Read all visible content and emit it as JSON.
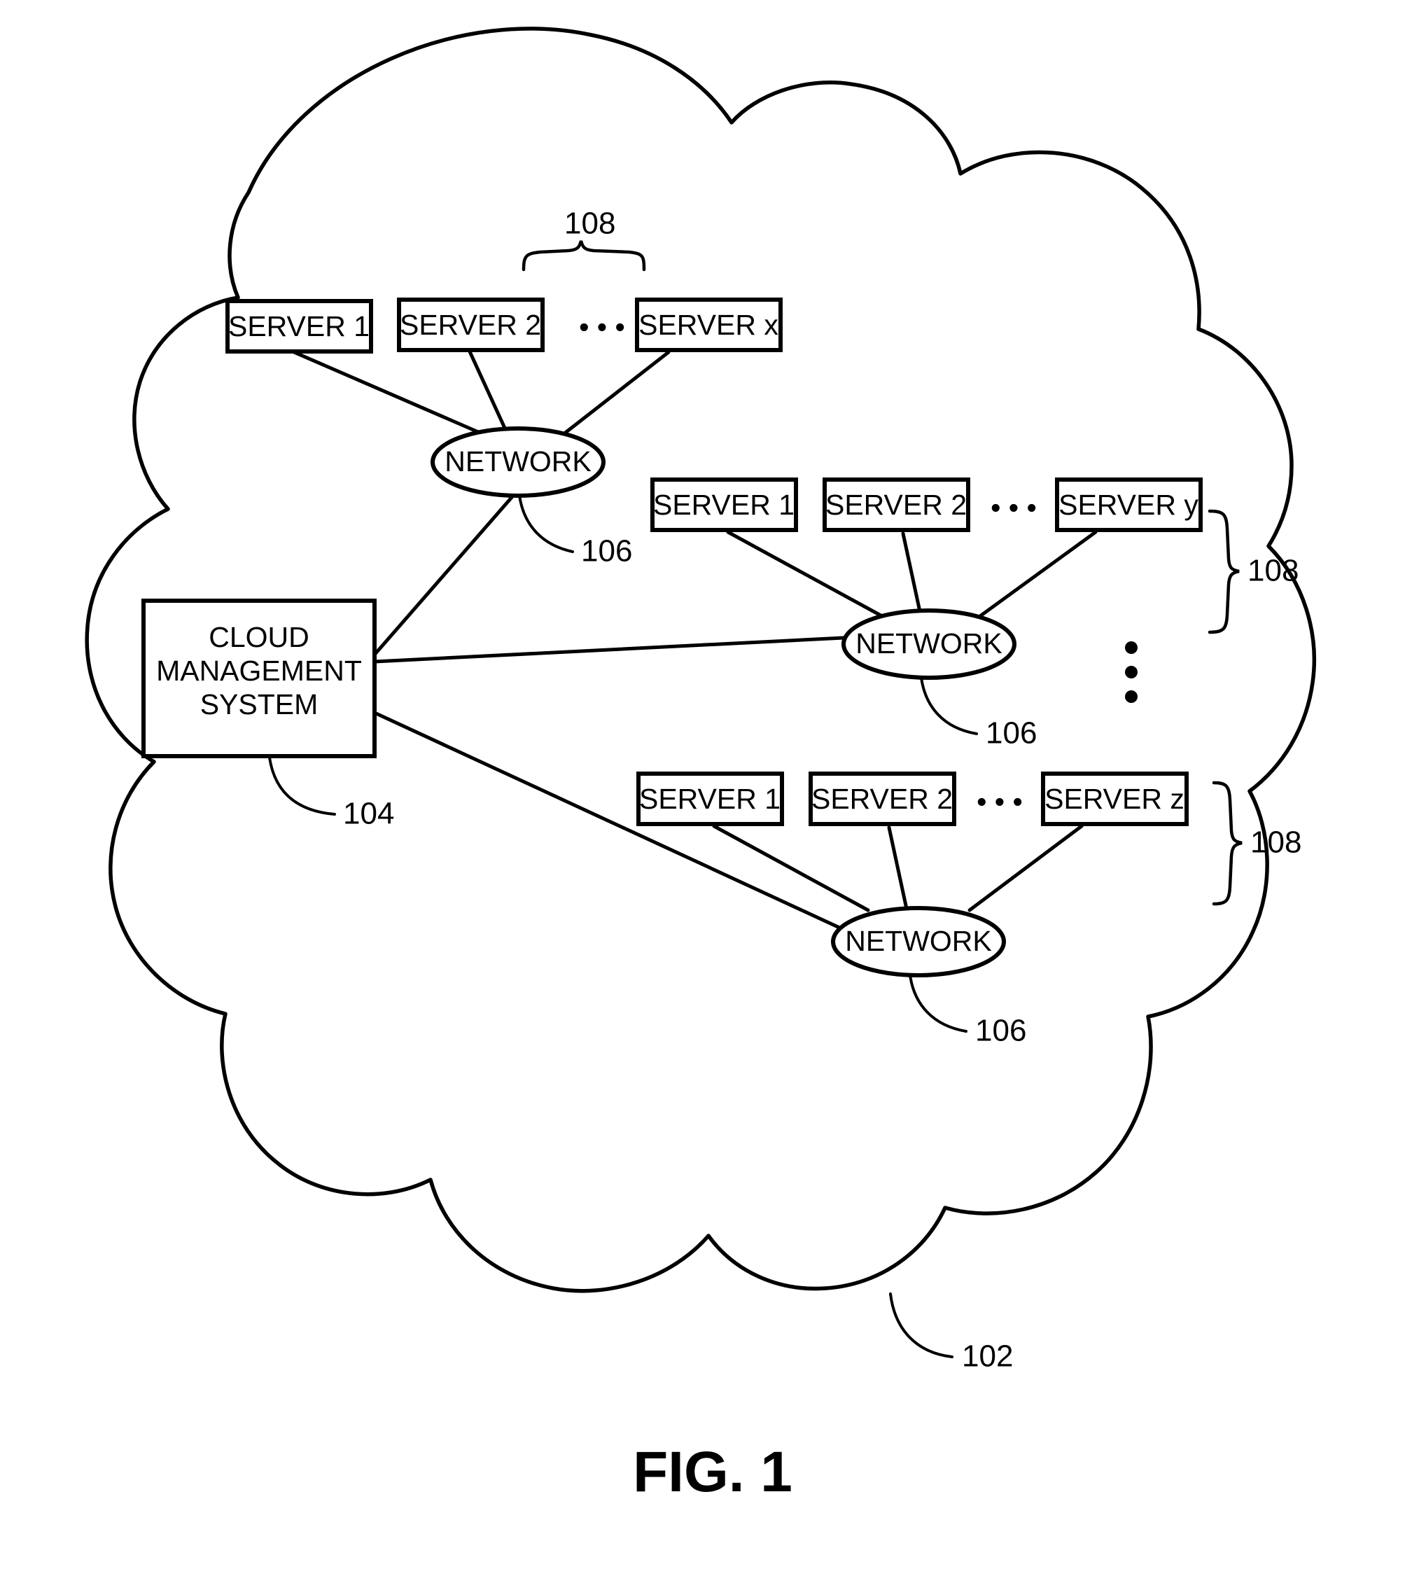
{
  "figure": {
    "caption": "FIG. 1",
    "cloud_label": "102",
    "cloud_name": "cloud-computing-environment"
  },
  "cms": {
    "lines": [
      "CLOUD",
      "MANAGEMENT",
      "SYSTEM"
    ],
    "ref": "104"
  },
  "groups": [
    {
      "id": "group-1",
      "servers": [
        "SERVER 1",
        "SERVER 2",
        "SERVER x"
      ],
      "ellipsis": "• • •",
      "network_label": "NETWORK",
      "network_ref": "106",
      "group_ref": "108",
      "brace_orientation": "top"
    },
    {
      "id": "group-2",
      "servers": [
        "SERVER 1",
        "SERVER 2",
        "SERVER y"
      ],
      "ellipsis": "• • •",
      "network_label": "NETWORK",
      "network_ref": "106",
      "group_ref": "108",
      "brace_orientation": "right"
    },
    {
      "id": "group-3",
      "servers": [
        "SERVER 1",
        "SERVER 2",
        "SERVER z"
      ],
      "ellipsis": "• • •",
      "network_label": "NETWORK",
      "network_ref": "106",
      "group_ref": "108",
      "brace_orientation": "right"
    }
  ],
  "vertical_ellipsis": "⋮",
  "colors": {
    "line": "#000000",
    "fill": "#ffffff",
    "text": "#000000"
  }
}
